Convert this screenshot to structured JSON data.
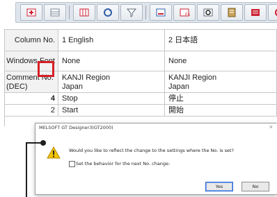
{
  "toolbar": {
    "buttons": [
      "add-row-icon",
      "insert-row-icon",
      "table-icon",
      "refresh-icon",
      "filter-icon",
      "import-icon",
      "export-icon",
      "search-icon",
      "book-icon",
      "flag-icon",
      "more-icon"
    ]
  },
  "table": {
    "rows": [
      {
        "header": "Column No.",
        "col1": "1 English",
        "col2": "2 日本語"
      },
      {
        "header": "Windows Font",
        "col1": "None",
        "col2": "None"
      },
      {
        "header": "Comment No. (DEC)",
        "col1": "KANJI Region\nJapan",
        "col2": "KANJI Region\nJapan"
      }
    ],
    "data_rows": [
      {
        "no": "4",
        "col1": "Stop",
        "col2": "停止"
      },
      {
        "no": "2",
        "col1": "Start",
        "col2": "開始"
      }
    ]
  },
  "dialog": {
    "title": "MELSOFT GT Designer3(GT2000)",
    "close": "×",
    "message": "Would you like to reflect the change to the settings where the No. is set?",
    "checkbox_label": "Set the behavior for the next No. change:",
    "yes_label": "Yes",
    "no_label": "No"
  },
  "colors": {
    "highlight": "#d61f26",
    "warning": "#f2c300"
  }
}
